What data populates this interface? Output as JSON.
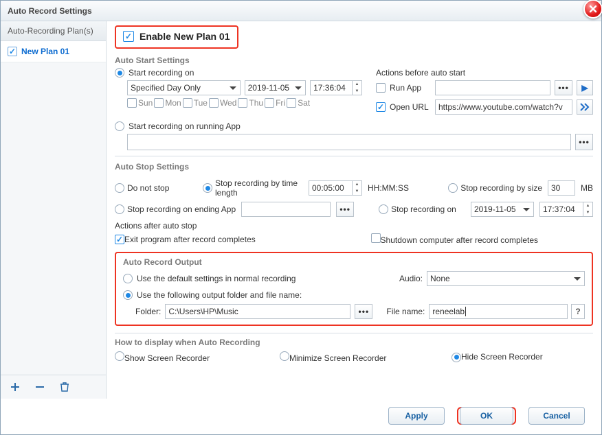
{
  "title": "Auto Record Settings",
  "sidebar": {
    "tab": "Auto-Recording Plan(s)",
    "plan": "New Plan 01"
  },
  "enable_label": "Enable New Plan 01",
  "auto_start": {
    "title": "Auto Start Settings",
    "opt_on": "Start recording on",
    "freq": "Specified Day Only",
    "date": "2019-11-05",
    "time": "17:36:04",
    "days": {
      "sun": "Sun",
      "mon": "Mon",
      "tue": "Tue",
      "wed": "Wed",
      "thu": "Thu",
      "fri": "Fri",
      "sat": "Sat"
    },
    "opt_app": "Start recording on running App",
    "actions_title": "Actions before auto start",
    "run_app": "Run App",
    "open_url": "Open URL",
    "url_value": "https://www.youtube.com/watch?v"
  },
  "auto_stop": {
    "title": "Auto Stop Settings",
    "do_not": "Do not stop",
    "by_time": "Stop recording by time length",
    "time_value": "00:05:00",
    "hhmmss": "HH:MM:SS",
    "by_size": "Stop recording by size",
    "size_value": "30",
    "mb": "MB",
    "ending_app": "Stop recording on ending App",
    "stop_on": "Stop recording on",
    "stop_date": "2019-11-05",
    "stop_time": "17:37:04",
    "actions_after": "Actions after auto stop",
    "exit_prog": "Exit program after record completes",
    "shutdown": "Shutdown computer after record completes"
  },
  "output": {
    "title": "Auto Record Output",
    "use_default": "Use the default settings in normal recording",
    "audio_label": "Audio:",
    "audio_value": "None",
    "use_following": "Use the following output folder and file name:",
    "folder_label": "Folder:",
    "folder_value": "C:\\Users\\HP\\Music",
    "filename_label": "File name:",
    "filename_value": "reneelab"
  },
  "how": {
    "title": "How to display when Auto Recording",
    "show": "Show Screen Recorder",
    "min": "Minimize Screen Recorder",
    "hide": "Hide Screen Recorder"
  },
  "buttons": {
    "apply": "Apply",
    "ok": "OK",
    "cancel": "Cancel"
  }
}
